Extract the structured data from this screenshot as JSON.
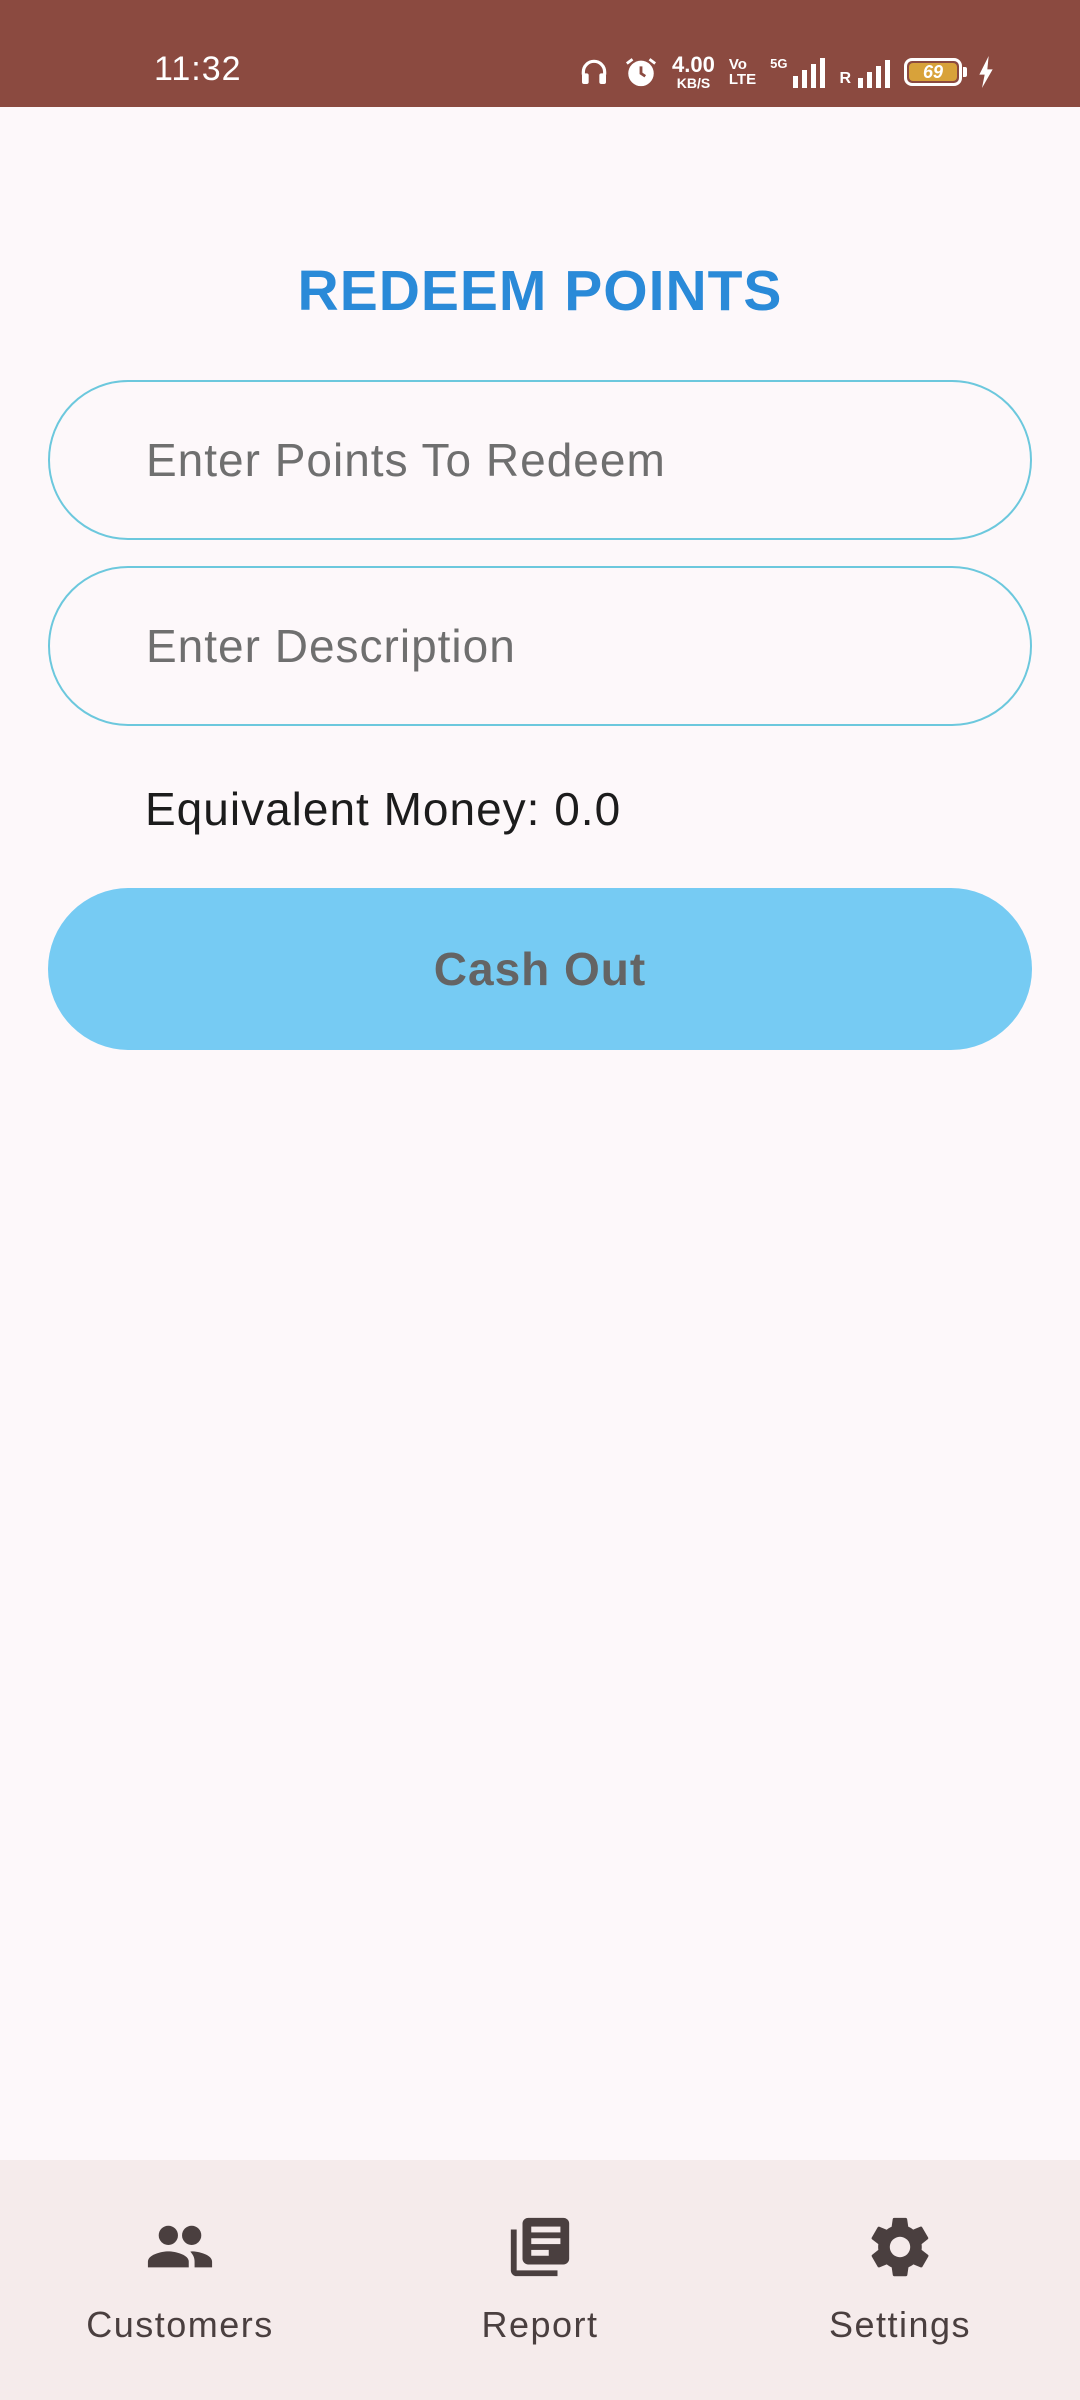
{
  "status_bar": {
    "time": "11:32",
    "net_speed_value": "4.00",
    "net_speed_unit": "KB/S",
    "volte_top": "Vo",
    "volte_bottom": "LTE",
    "network_type": "5G",
    "roaming": "R",
    "battery_level": "69",
    "icons": [
      "headphones-icon",
      "alarm-icon",
      "signal-icon",
      "battery-icon",
      "charging-icon"
    ]
  },
  "page": {
    "title": "REDEEM POINTS",
    "points_placeholder": "Enter Points To Redeem",
    "points_value": "",
    "description_placeholder": "Enter Description",
    "description_value": "",
    "equivalent_money": "Equivalent Money: 0.0",
    "cash_out_label": "Cash Out"
  },
  "bottom_nav": {
    "items": [
      {
        "label": "Customers",
        "icon": "people-icon"
      },
      {
        "label": "Report",
        "icon": "report-icon"
      },
      {
        "label": "Settings",
        "icon": "gear-icon"
      }
    ]
  },
  "colors": {
    "status_bar": "#8b4a40",
    "title": "#2a8ad8",
    "field_border": "#6cc8dd",
    "button": "#76cbf3",
    "background": "#fdf8fa",
    "nav_background": "#f5ebeb"
  }
}
